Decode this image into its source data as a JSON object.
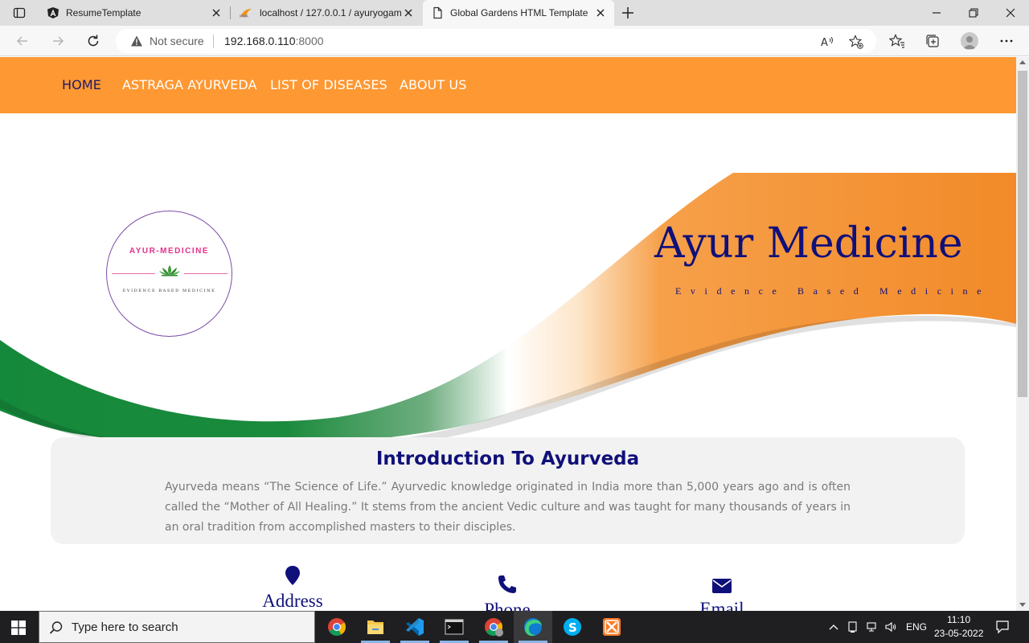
{
  "browser": {
    "tabs": [
      {
        "title": "ResumeTemplate",
        "icon": "angular-logo-icon"
      },
      {
        "title": "localhost / 127.0.0.1 / ayuryogam",
        "icon": "phpmyadmin-logo-icon"
      },
      {
        "title": "Global Gardens HTML Template",
        "icon": "page-icon"
      }
    ],
    "address": {
      "security_label": "Not secure",
      "host": "192.168.0.110",
      "port": ":8000"
    }
  },
  "site": {
    "nav": [
      "HOME",
      "ASTRAGA AYURVEDA",
      "LIST OF DISEASES",
      "ABOUT US"
    ],
    "logo": {
      "name": "AYUR-MEDICINE",
      "tagline": "EVIDENCE BASED MEDICINE"
    },
    "hero": {
      "title": "Ayur Medicine",
      "subtitle": "Evidence Based Medicine"
    },
    "intro": {
      "title": "Introduction To Ayurveda",
      "text": "Ayurveda means “The Science of Life.” Ayurvedic knowledge originated in India more than 5,000 years ago and is often called the “Mother of All Healing.” It stems from the ancient Vedic culture and was taught for many thousands of years in an oral tradition from accomplished masters to their disciples."
    },
    "contact": [
      {
        "label": "Address",
        "icon": "map-marker-icon"
      },
      {
        "label": "Phone",
        "icon": "phone-icon"
      },
      {
        "label": "Email",
        "icon": "envelope-icon"
      }
    ],
    "colors": {
      "nav_bg": "#fe9832",
      "accent_navy": "#10107a",
      "green": "#1b8a3a",
      "saffron": "#f28a28"
    }
  },
  "taskbar": {
    "search_placeholder": "Type here to search",
    "apps": [
      "chrome-icon",
      "file-explorer-icon",
      "vscode-icon",
      "terminal-icon",
      "chrome-profile-icon",
      "edge-icon",
      "skype-icon",
      "xampp-icon"
    ],
    "language": "ENG",
    "time": "11:10",
    "date": "23-05-2022"
  }
}
